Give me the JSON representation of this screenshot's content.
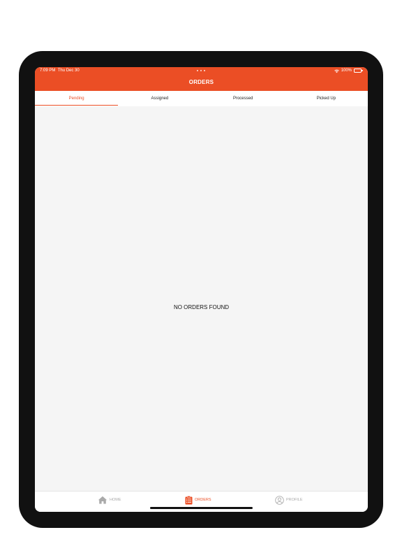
{
  "status_bar": {
    "time": "7:09 PM",
    "date": "Thu Dec 30",
    "battery": "100%",
    "wifi_icon": "wifi-icon",
    "battery_icon": "battery-icon"
  },
  "header": {
    "title": "ORDERS",
    "color": "#eb4e25"
  },
  "tabs": [
    {
      "label": "Pending",
      "active": true
    },
    {
      "label": "Assigned",
      "active": false
    },
    {
      "label": "Processed",
      "active": false
    },
    {
      "label": "Picked Up",
      "active": false
    }
  ],
  "content": {
    "empty_message": "NO ORDERS FOUND"
  },
  "tab_bar": {
    "items": [
      {
        "label": "HOME",
        "icon": "home-icon",
        "active": false
      },
      {
        "label": "ORDERS",
        "icon": "clipboard-list-icon",
        "active": true
      },
      {
        "label": "PROFILE",
        "icon": "user-circle-icon",
        "active": false
      }
    ]
  },
  "colors": {
    "accent": "#eb4e25",
    "inactive": "#aaaaaa",
    "background": "#f5f5f5"
  }
}
